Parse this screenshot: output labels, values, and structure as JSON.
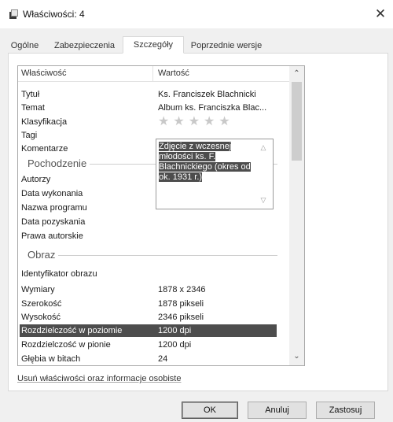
{
  "window": {
    "title": "Właściwości: 4",
    "close_glyph": "✕"
  },
  "tabs": [
    {
      "label": "Ogólne",
      "selected": false
    },
    {
      "label": "Zabezpieczenia",
      "selected": false
    },
    {
      "label": "Szczegóły",
      "selected": true
    },
    {
      "label": "Poprzednie wersje",
      "selected": false
    }
  ],
  "details": {
    "col_property": "Właściwość",
    "col_value": "Wartość",
    "rows_description": [
      {
        "name": "Tytuł",
        "value": "Ks. Franciszek Blachnicki"
      },
      {
        "name": "Temat",
        "value": "Album ks. Franciszka Blac..."
      },
      {
        "name": "Klasyfikacja",
        "value": ""
      },
      {
        "name": "Tagi",
        "value": ""
      },
      {
        "name": "Komentarze",
        "value": ""
      }
    ],
    "rating": {
      "stars_total": 5,
      "stars_filled": 0,
      "glyph": "★★★★★"
    },
    "comment": "Zdjęcie z wczesnej młodości ks. F. Blachnickiego (okres od ok. 1931 r.)",
    "group_origin": "Pochodzenie",
    "rows_origin": [
      {
        "name": "Autorzy",
        "value": ""
      },
      {
        "name": "Data wykonania",
        "value": ""
      },
      {
        "name": "Nazwa programu",
        "value": ""
      },
      {
        "name": "Data pozyskania",
        "value": ""
      },
      {
        "name": "Prawa autorskie",
        "value": ""
      }
    ],
    "group_image": "Obraz",
    "rows_image": [
      {
        "name": "Identyfikator obrazu",
        "value": ""
      },
      {
        "name": "Wymiary",
        "value": "1878 x 2346"
      },
      {
        "name": "Szerokość",
        "value": "1878 pikseli"
      },
      {
        "name": "Wysokość",
        "value": "2346 pikseli"
      },
      {
        "name": "Rozdzielczość w poziomie",
        "value": "1200 dpi",
        "selected": true
      },
      {
        "name": "Rozdzielczość w pionie",
        "value": "1200 dpi"
      },
      {
        "name": "Głębia w bitach",
        "value": "24"
      }
    ]
  },
  "remove_link": "Usuń właściwości oraz informacje osobiste",
  "buttons": {
    "ok": "OK",
    "cancel": "Anuluj",
    "apply": "Zastosuj"
  },
  "colors": {
    "selection": "#4d4d4d",
    "window_bg": "#f0f0f0",
    "panel_bg": "#ffffff"
  }
}
